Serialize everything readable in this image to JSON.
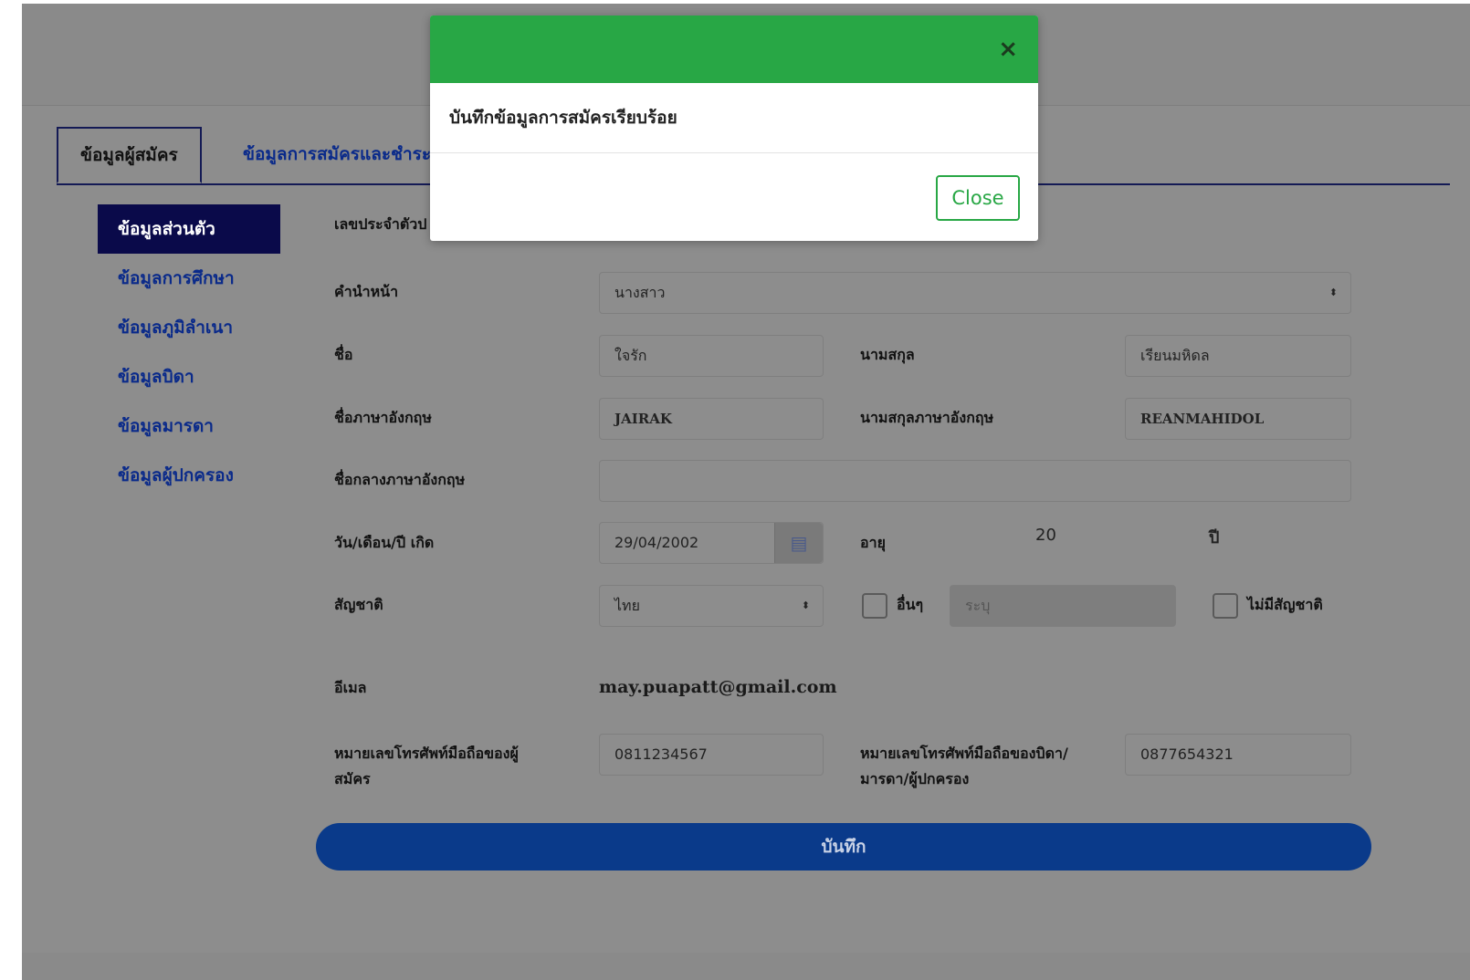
{
  "tabs": [
    "ข้อมูลผู้สมัคร",
    "ข้อมูลการสมัครและชำระเงิน"
  ],
  "sidenav": [
    "ข้อมูลส่วนตัว",
    "ข้อมูลการศึกษา",
    "ข้อมูลภูมิลำเนา",
    "ข้อมูลบิดา",
    "ข้อมูลมารดา",
    "ข้อมูลผู้ปกครอง"
  ],
  "form": {
    "id_label": "เลขประจำตัวป",
    "title_label": "คำนำหน้า",
    "title_value": "นางสาว",
    "firstname_label": "ชื่อ",
    "firstname_value": "ใจรัก",
    "lastname_label": "นามสกุล",
    "lastname_value": "เรียนมหิดล",
    "firstname_en_label": "ชื่อภาษาอังกฤษ",
    "firstname_en_value": "JAIRAK",
    "lastname_en_label": "นามสกุลภาษาอังกฤษ",
    "lastname_en_value": "REANMAHIDOL",
    "middlename_en_label": "ชื่อกลางภาษาอังกฤษ",
    "middlename_en_value": "",
    "dob_label": "วัน/เดือน/ปี เกิด",
    "dob_value": "29/04/2002",
    "age_label": "อายุ",
    "age_value": "20",
    "age_unit": "ปี",
    "nationality_label": "สัญชาติ",
    "nationality_value": "ไทย",
    "other_label": "อื่นๆ",
    "other_placeholder": "ระบุ",
    "no_nationality_label": "ไม่มีสัญชาติ",
    "email_label": "อีเมล",
    "email_value": "may.puapatt@gmail.com",
    "phone_label": "หมายเลขโทรศัพท์มือถือของผู้สมัคร",
    "phone_value": "0811234567",
    "parent_phone_label": "หมายเลขโทรศัพท์มือถือของบิดา/มารดา/ผู้ปกครอง",
    "parent_phone_value": "0877654321",
    "save_label": "บันทึก"
  },
  "modal": {
    "message": "บันทึกข้อมูลการสมัครเรียบร้อย",
    "close_x": "×",
    "close_label": "Close",
    "header_color": "#28a745"
  },
  "colors": {
    "accent": "#0a3a8a",
    "nav_active": "#0a0a4a",
    "success": "#28a745"
  }
}
